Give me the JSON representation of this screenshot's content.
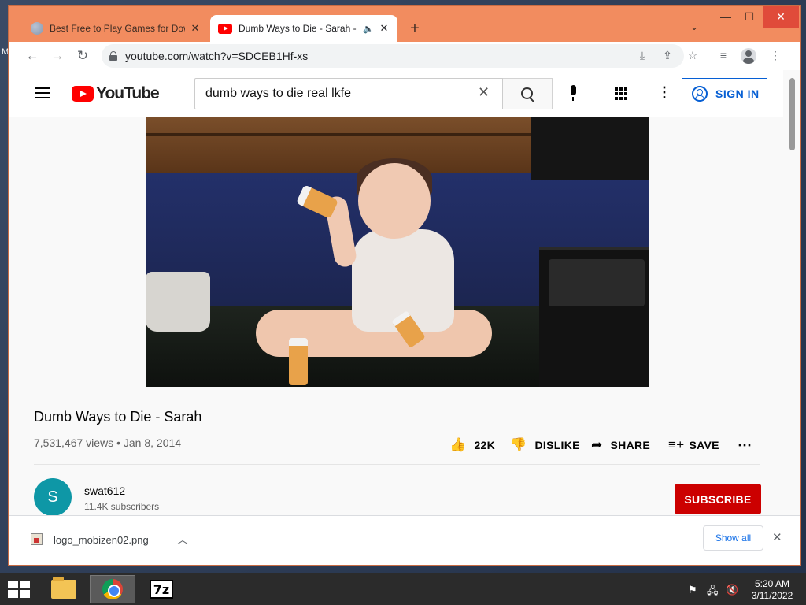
{
  "desktop": {
    "edge_fragment": "M"
  },
  "browser": {
    "tabs": [
      {
        "title": "Best Free to Play Games for Dow",
        "close": "✕"
      },
      {
        "title": "Dumb Ways to Die - Sarah -",
        "speaker": "🔈",
        "close": "✕"
      }
    ],
    "new_tab": "+",
    "tab_search": "⌄",
    "window_controls": {
      "minimize": "—",
      "maximize": "☐",
      "close": "✕"
    },
    "toolbar": {
      "back": "←",
      "forward": "→",
      "reload": "↻",
      "url": "youtube.com/watch?v=SDCEB1Hf-xs",
      "install": "⤓",
      "share": "⇪",
      "bookmark": "☆",
      "reading_list": "≡",
      "menu": "⋮"
    }
  },
  "youtube": {
    "logo_text": "YouTube",
    "search": {
      "query": "dumb ways to die real lkfe",
      "clear": "✕"
    },
    "kebab": "⋮",
    "sign_in": "SIGN IN",
    "video": {
      "title": "Dumb Ways to Die - Sarah",
      "views": "7,531,467 views",
      "date": "Jan 8, 2014"
    },
    "actions": {
      "like_icon": "👍",
      "like_count": "22K",
      "dislike_icon": "👎",
      "dislike": "DISLIKE",
      "share_icon": "➦",
      "share": "SHARE",
      "save_icon": "≡+",
      "save": "SAVE",
      "more": "⋯"
    },
    "channel": {
      "avatar_letter": "S",
      "name": "swat612",
      "subscribers": "11.4K subscribers",
      "subscribe": "SUBSCRIBE"
    }
  },
  "downloads": {
    "file_name": "logo_mobizen02.png",
    "chevron": "︿",
    "show_all": "Show all",
    "close": "✕"
  },
  "taskbar": {
    "sevenzip_label": "7z",
    "tray": {
      "flag": "⚑",
      "network": "🖧",
      "volume": "🔇"
    },
    "time": "5:20 AM",
    "date": "3/11/2022"
  }
}
